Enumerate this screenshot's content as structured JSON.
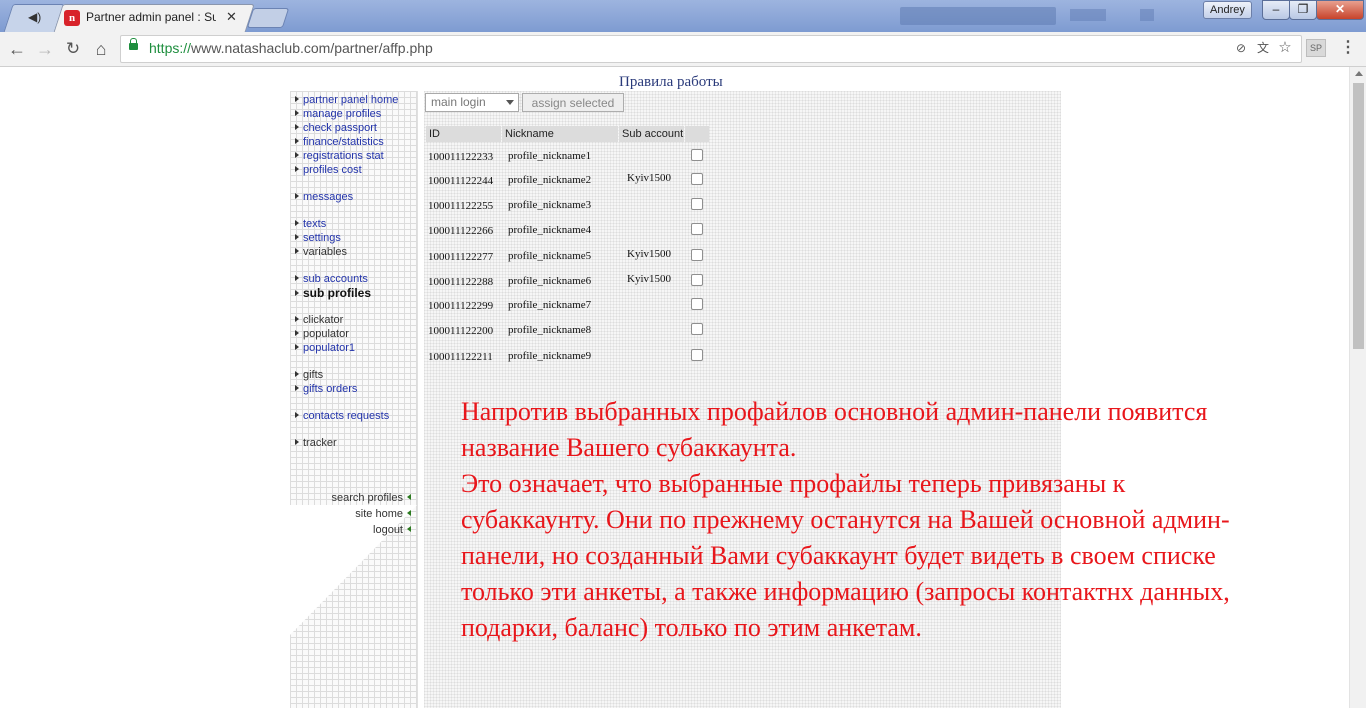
{
  "browser": {
    "tabs": [
      {
        "title": "Partner admin panel : Sub profiles",
        "active": true
      },
      {
        "title": "",
        "active": false
      }
    ],
    "user": "Andrey",
    "url": {
      "scheme": "https://",
      "host": "www.natashaclub.com",
      "path": "/partner/affp.php"
    },
    "ext_label": "SP",
    "icons": [
      "back-icon",
      "forward-icon",
      "reload-icon",
      "home-icon",
      "lock-icon",
      "star-icon",
      "translate-icon",
      "menu-icon"
    ]
  },
  "page": {
    "rules_link": "Правила работы",
    "sidebar": {
      "items": [
        {
          "label": "partner panel home",
          "style": "link"
        },
        {
          "label": "manage profiles",
          "style": "link"
        },
        {
          "label": "check passport",
          "style": "link"
        },
        {
          "label": "finance/statistics",
          "style": "link"
        },
        {
          "label": "registrations stat",
          "style": "link"
        },
        {
          "label": "profiles cost",
          "style": "link"
        },
        {
          "label": "messages",
          "style": "link"
        },
        {
          "label": "texts",
          "style": "link"
        },
        {
          "label": "settings",
          "style": "link"
        },
        {
          "label": "variables",
          "style": "plain"
        },
        {
          "label": "sub accounts",
          "style": "link"
        },
        {
          "label": "sub profiles",
          "style": "current"
        },
        {
          "label": "clickator",
          "style": "plain"
        },
        {
          "label": "populator",
          "style": "plain"
        },
        {
          "label": "populator1",
          "style": "link"
        },
        {
          "label": "gifts",
          "style": "plain"
        },
        {
          "label": "gifts orders",
          "style": "link"
        },
        {
          "label": "contacts requests",
          "style": "link"
        },
        {
          "label": "tracker",
          "style": "plain"
        }
      ],
      "bottom_links": [
        "search profiles",
        "site home",
        "logout"
      ]
    },
    "controls": {
      "select_value": "main login",
      "assign_button": "assign selected"
    },
    "table": {
      "headers": [
        "ID",
        "Nickname",
        "Sub account",
        ""
      ],
      "rows": [
        {
          "id": "100011122233",
          "nickname": "profile_nickname1",
          "sub": "",
          "checked": false
        },
        {
          "id": "100011122244",
          "nickname": "profile_nickname2",
          "sub": "Kyiv1500",
          "checked": false
        },
        {
          "id": "100011122255",
          "nickname": "profile_nickname3",
          "sub": "",
          "checked": false
        },
        {
          "id": "100011122266",
          "nickname": "profile_nickname4",
          "sub": "",
          "checked": false
        },
        {
          "id": "100011122277",
          "nickname": "profile_nickname5",
          "sub": "Kyiv1500",
          "checked": false
        },
        {
          "id": "100011122288",
          "nickname": "profile_nickname6",
          "sub": "Kyiv1500",
          "checked": false
        },
        {
          "id": "100011122299",
          "nickname": "profile_nickname7",
          "sub": "",
          "checked": false
        },
        {
          "id": "100011122200",
          "nickname": "profile_nickname8",
          "sub": "",
          "checked": false
        },
        {
          "id": "100011122211",
          "nickname": "profile_nickname9",
          "sub": "",
          "checked": false
        }
      ]
    },
    "annotation": {
      "paragraph1": "Напротив выбранных профайлов основной админ-панели появится название Вашего субаккаунта.",
      "paragraph2": "Это означает, что выбранные профайлы теперь привязаны к субаккаунту. Они по прежнему останутся на Вашей основной админ-панели, но созданный Вами субаккаунт будет видеть в своем списке только эти анкеты, а также информацию (запросы контактнх данных, подарки, баланс) только по этим анкетам.",
      "color": "#e8161b"
    }
  }
}
